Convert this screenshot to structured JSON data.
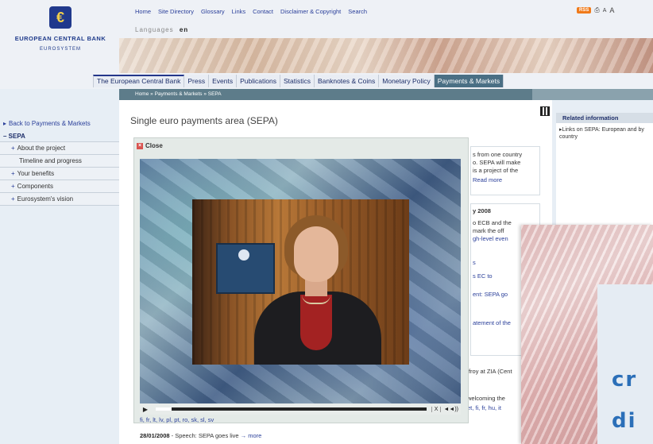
{
  "bank": {
    "logo_glyph": "€",
    "name": "EUROPEAN CENTRAL BANK",
    "subtitle": "EUROSYSTEM"
  },
  "topnav": [
    "Home",
    "Site Directory",
    "Glossary",
    "Links",
    "Contact",
    "Disclaimer & Copyright",
    "Search"
  ],
  "language": {
    "label": "Languages",
    "value": "en"
  },
  "toolbar": {
    "rss_label": "RSS",
    "print_icon": "print-icon",
    "font_small": "A",
    "font_large": "A"
  },
  "tabs": [
    {
      "label": "The European Central Bank",
      "active": false
    },
    {
      "label": "Press",
      "active": false
    },
    {
      "label": "Events",
      "active": false
    },
    {
      "label": "Publications",
      "active": false
    },
    {
      "label": "Statistics",
      "active": false
    },
    {
      "label": "Banknotes & Coins",
      "active": false
    },
    {
      "label": "Monetary Policy",
      "active": false
    },
    {
      "label": "Payments & Markets",
      "active": true
    }
  ],
  "breadcrumb": "Home » Payments & Markets » SEPA",
  "leftnav": {
    "back": "Back to Payments & Markets",
    "section": "SEPA",
    "items": [
      {
        "label": "About the project",
        "sub": false
      },
      {
        "label": "Timeline and progress",
        "sub": true
      },
      {
        "label": "Your benefits",
        "sub": false
      },
      {
        "label": "Components",
        "sub": false
      },
      {
        "label": "Eurosystem's vision",
        "sub": false
      }
    ]
  },
  "page_title": "Single euro payments area (SEPA)",
  "related": {
    "heading": "Related information",
    "link": "Links on SEPA: European and by country"
  },
  "player": {
    "close_label": "Close",
    "progress": 0.06,
    "play_icon": "play-icon",
    "stop_label": "X",
    "volume_label": "◄◄))"
  },
  "peek_text": {
    "line1": "s from one country",
    "line2": "o. SEPA will make",
    "line3": "is a project of the",
    "line4": "Read more",
    "line5": "y 2008",
    "line6": "o ECB and the",
    "line7": "mark the off",
    "line8": "gh-level even",
    "line9": "s",
    "line10": "s EC to",
    "line11": "ent: SEPA go",
    "line12": "atement of the",
    "line13": "ffroy at ZIA (Cent",
    "line14": "welcoming the",
    "line15": "et, fi, fr, hu, it"
  },
  "language_links": "fi, fr, lt, lv, pl, pt, ro, sk, sl, sv",
  "news": {
    "date": "28/01/2008",
    "text": " - Speech: SEPA goes live",
    "more": "more"
  },
  "brochure": {
    "line1": "cr",
    "line2": "di"
  }
}
